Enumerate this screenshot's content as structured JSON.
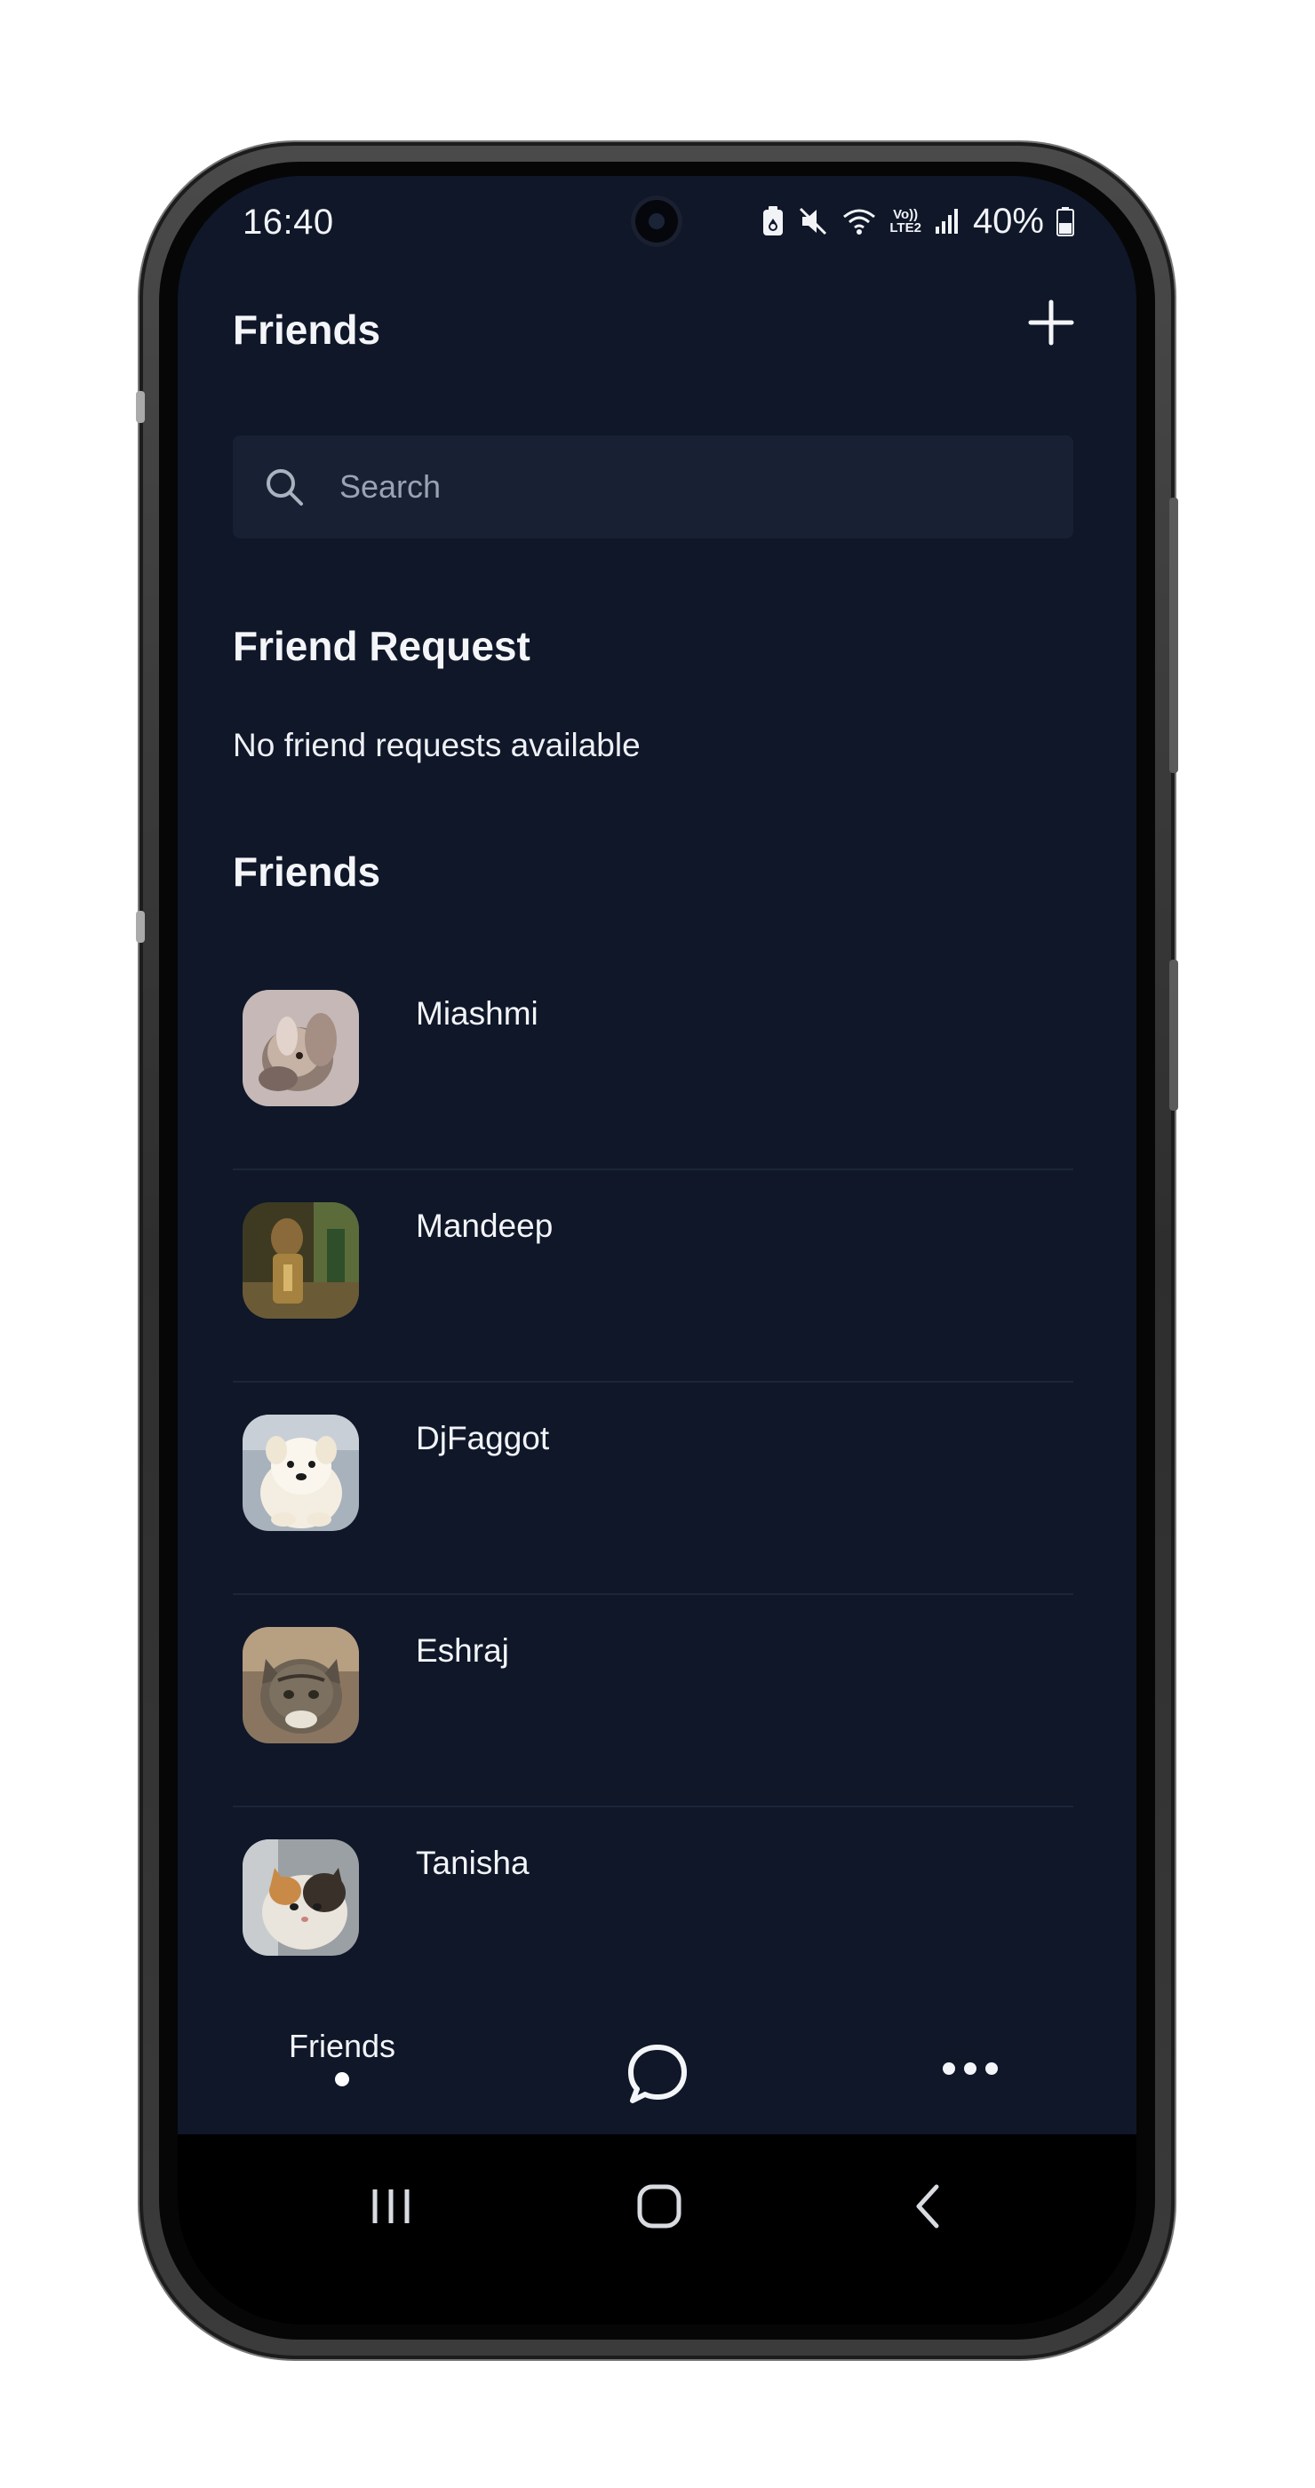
{
  "status_bar": {
    "time": "16:40",
    "battery_percent": "40%",
    "icons": [
      "battery-saver-icon",
      "mute-icon",
      "wifi-icon",
      "volte-lte2-icon",
      "signal-icon",
      "battery-icon"
    ],
    "network_label_top": "Vo))",
    "network_label_bottom": "LTE2"
  },
  "header": {
    "title": "Friends",
    "add_icon": "plus-icon"
  },
  "search": {
    "placeholder": "Search",
    "value": ""
  },
  "friend_requests": {
    "title": "Friend Request",
    "empty_message": "No friend requests available"
  },
  "friends": {
    "title": "Friends",
    "items": [
      {
        "name": "Miashmi"
      },
      {
        "name": "Mandeep"
      },
      {
        "name": "DjFaggot"
      },
      {
        "name": "Eshraj"
      },
      {
        "name": "Tanisha"
      }
    ]
  },
  "bottom_nav": {
    "friends_label": "Friends",
    "active_tab": "friends",
    "chat_icon": "chat-bubble-icon",
    "more_icon": "more-horizontal-icon"
  },
  "system_nav": {
    "recents_icon": "recents-icon",
    "home_icon": "home-icon",
    "back_icon": "back-icon"
  },
  "colors": {
    "background": "#0f1729",
    "search_background": "#172133",
    "text": "#f4f5f8",
    "divider": "#1c2638"
  }
}
